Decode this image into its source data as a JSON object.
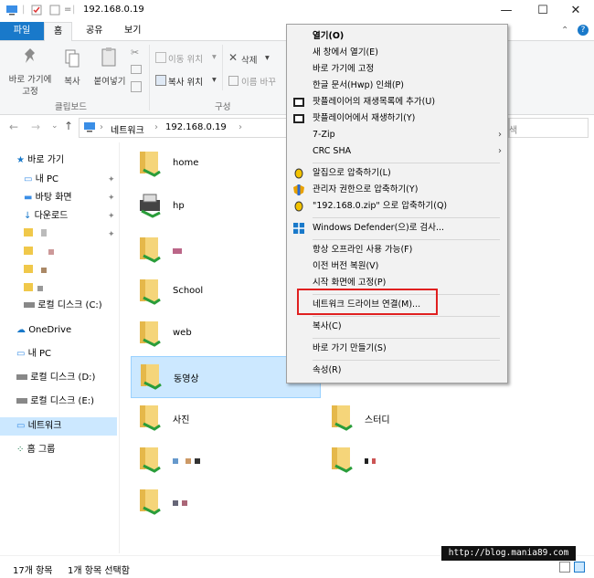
{
  "window": {
    "address_title": "192.168.0.19",
    "controls": {
      "minimize": "—",
      "maximize": "☐",
      "close": "✕"
    }
  },
  "ribbon": {
    "tabs": [
      "파일",
      "홈",
      "공유",
      "보기"
    ],
    "clipboard": {
      "pin_label_1": "바로 가기에",
      "pin_label_2": "고정",
      "copy": "복사",
      "paste": "붙여넣기",
      "group": "클립보드"
    },
    "organize": {
      "move_to": "이동 위치",
      "copy_to": "복사 위치",
      "delete": "삭제",
      "rename": "이름 바꾸",
      "group": "구성"
    }
  },
  "nav": {
    "breadcrumb": [
      "네트워크",
      "192.168.0.19"
    ],
    "search_partial": "색"
  },
  "sidebar": {
    "items": [
      {
        "label": "바로 가기",
        "icon": "star-icon"
      },
      {
        "label": "내 PC",
        "icon": "pc-icon"
      },
      {
        "label": "바탕 화면",
        "icon": "desktop-icon"
      },
      {
        "label": "다운로드",
        "icon": "download-icon"
      },
      {
        "label": "",
        "icon": "folder-icon"
      },
      {
        "label": "",
        "icon": "folder-icon"
      },
      {
        "label": "",
        "icon": "folder-icon"
      },
      {
        "label": "",
        "icon": "folder-icon"
      },
      {
        "label": "로컬 디스크 (C:)",
        "icon": "drive-icon"
      },
      {
        "label": "OneDrive",
        "icon": "cloud-icon"
      },
      {
        "label": "내 PC",
        "icon": "pc-icon"
      },
      {
        "label": "로컬 디스크 (D:)",
        "icon": "drive-icon"
      },
      {
        "label": "로컬 디스크 (E:)",
        "icon": "drive-icon"
      },
      {
        "label": "네트워크",
        "icon": "network-icon"
      },
      {
        "label": "홈 그룹",
        "icon": "homegroup-icon"
      }
    ]
  },
  "content": {
    "items": [
      {
        "name": "home",
        "icon": "shared-folder-icon"
      },
      {
        "name": "hp",
        "icon": "printer-icon"
      },
      {
        "name": "",
        "icon": "shared-folder-icon"
      },
      {
        "name": "School",
        "icon": "shared-folder-icon"
      },
      {
        "name": "web",
        "icon": "shared-folder-icon"
      },
      {
        "name": "동영상",
        "icon": "shared-folder-icon"
      },
      {
        "name": "사진",
        "icon": "shared-folder-icon"
      },
      {
        "name": "스터디",
        "icon": "shared-folder-icon"
      },
      {
        "name": "",
        "icon": "shared-folder-icon"
      },
      {
        "name": "",
        "icon": "shared-folder-icon"
      },
      {
        "name": "",
        "icon": "shared-folder-icon"
      }
    ]
  },
  "status": {
    "count": "17개 항목",
    "selected": "1개 항목 선택함"
  },
  "context_menu": {
    "items": [
      "열기(O)",
      "새 창에서 열기(E)",
      "바로 가기에 고정",
      "한글 문서(Hwp) 인쇄(P)",
      "팟플레이어의 재생목록에 추가(U)",
      "팟플레이어에서 재생하기(Y)",
      "7-Zip",
      "CRC SHA",
      "알집으로 압축하기(L)",
      "관리자 권한으로 압축하기(Y)",
      "\"192.168.0.zip\" 으로 압축하기(Q)",
      "Windows Defender(으)로 검사...",
      "항상 오프라인 사용 가능(F)",
      "이전 버전 복원(V)",
      "시작 화면에 고정(P)",
      "네트워크 드라이브 연결(M)...",
      "복사(C)",
      "바로 가기 만들기(S)",
      "속성(R)"
    ],
    "highlight_color": "#e02020"
  },
  "watermark": "http://blog.mania89.com"
}
